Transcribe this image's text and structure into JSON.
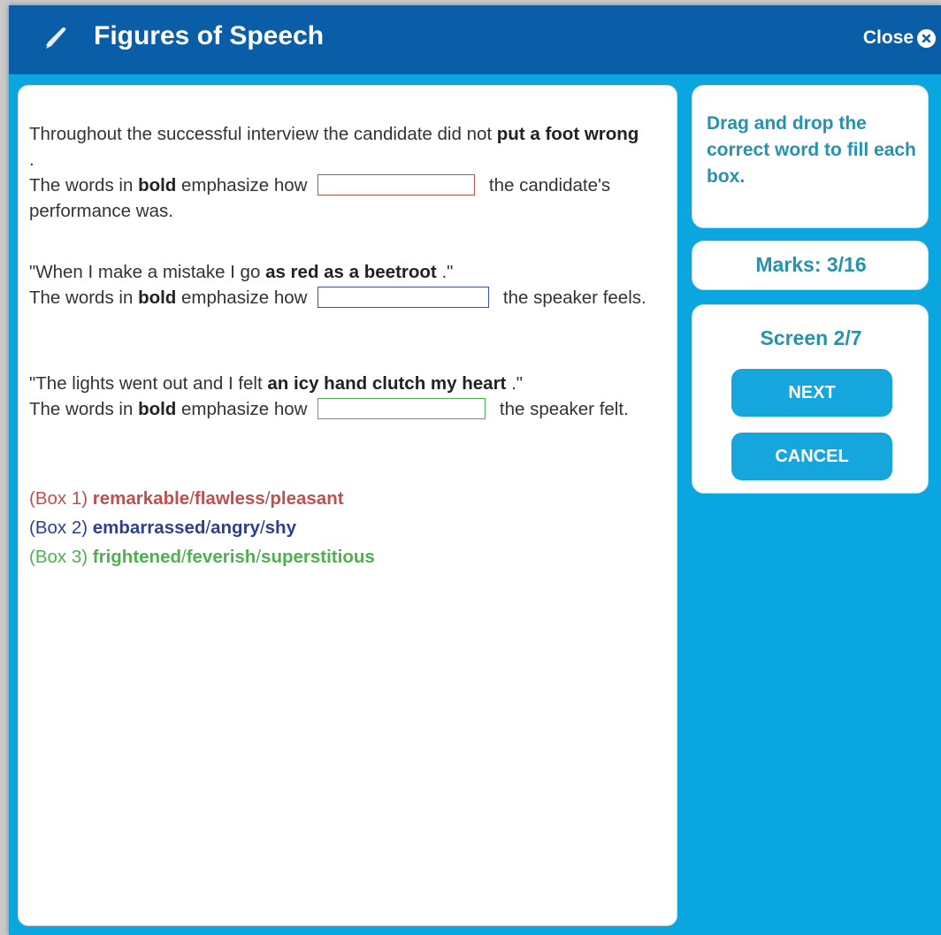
{
  "header": {
    "title": "Figures of Speech",
    "close_label": "Close",
    "pen_icon": "pen-icon",
    "close_icon": "close-circle-icon"
  },
  "questions": [
    {
      "line1_pre": "Throughout the successful interview the candidate did not ",
      "bold_phrase": "put a foot wrong",
      "line1_post": " .",
      "prompt_pre": "The words in ",
      "prompt_bold": "bold",
      "prompt_mid": " emphasize how",
      "prompt_post": "the candidate's performance was."
    },
    {
      "line1_pre": "\"When I make a mistake I go ",
      "bold_phrase": "as red as a beetroot",
      "line1_post": " .\"",
      "prompt_pre": "The words in ",
      "prompt_bold": "bold",
      "prompt_mid": " emphasize how",
      "prompt_post": "the speaker feels."
    },
    {
      "line1_pre": "\"The lights went out and I felt ",
      "bold_phrase": "an icy hand clutch my heart",
      "line1_post": " .\"",
      "prompt_pre": "The words in ",
      "prompt_bold": "bold",
      "prompt_mid": " emphasize how",
      "prompt_post": "the speaker felt."
    }
  ],
  "options": [
    {
      "label": "(Box 1)",
      "words": [
        "remarkable",
        "flawless",
        "pleasant"
      ],
      "color": "#c0504d"
    },
    {
      "label": "(Box 2)",
      "words": [
        "embarrassed",
        "angry",
        "shy"
      ],
      "color": "#2e3f8f"
    },
    {
      "label": "(Box 3)",
      "words": [
        "frightened",
        "feverish",
        "superstitious"
      ],
      "color": "#4fb04f"
    }
  ],
  "sidebar": {
    "instruction": "Drag and drop the correct word to fill each box.",
    "marks": "Marks: 3/16",
    "screen": "Screen 2/7",
    "next_label": "NEXT",
    "cancel_label": "CANCEL"
  },
  "colors": {
    "header_bg": "#0a5ea8",
    "window_bg": "#0aa6df",
    "accent_text": "#2593ad",
    "button_bg": "#14a6dc"
  }
}
